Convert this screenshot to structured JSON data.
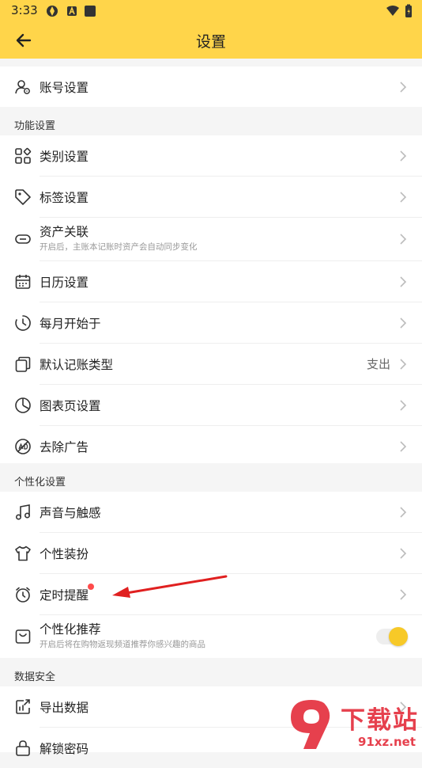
{
  "status_bar": {
    "time": "3:33"
  },
  "app_bar": {
    "title": "设置"
  },
  "account": {
    "label": "账号设置"
  },
  "sections": {
    "features": "功能设置",
    "personalization": "个性化设置",
    "data_security": "数据安全"
  },
  "features_items": [
    {
      "label": "类别设置"
    },
    {
      "label": "标签设置"
    },
    {
      "label": "资产关联",
      "sub": "开启后，主账本记账时资产会自动同步变化"
    },
    {
      "label": "日历设置"
    },
    {
      "label": "每月开始于"
    },
    {
      "label": "默认记账类型",
      "value": "支出"
    },
    {
      "label": "图表页设置"
    },
    {
      "label": "去除广告"
    }
  ],
  "personal_items": [
    {
      "label": "声音与触感"
    },
    {
      "label": "个性装扮"
    },
    {
      "label": "定时提醒"
    },
    {
      "label": "个性化推荐",
      "sub": "开启后将在购物返现频道推荐你感兴趣的商品",
      "toggle_on": true
    }
  ],
  "data_items": [
    {
      "label": "导出数据"
    },
    {
      "label": "解锁密码"
    }
  ],
  "watermark": {
    "brand": "下载站",
    "url": "91xz.net",
    "logo_text": "9"
  },
  "colors": {
    "accent": "#ffd54a",
    "toggle_knob": "#f7c928",
    "badge": "#ff4b4b",
    "arrow": "#e02020"
  }
}
